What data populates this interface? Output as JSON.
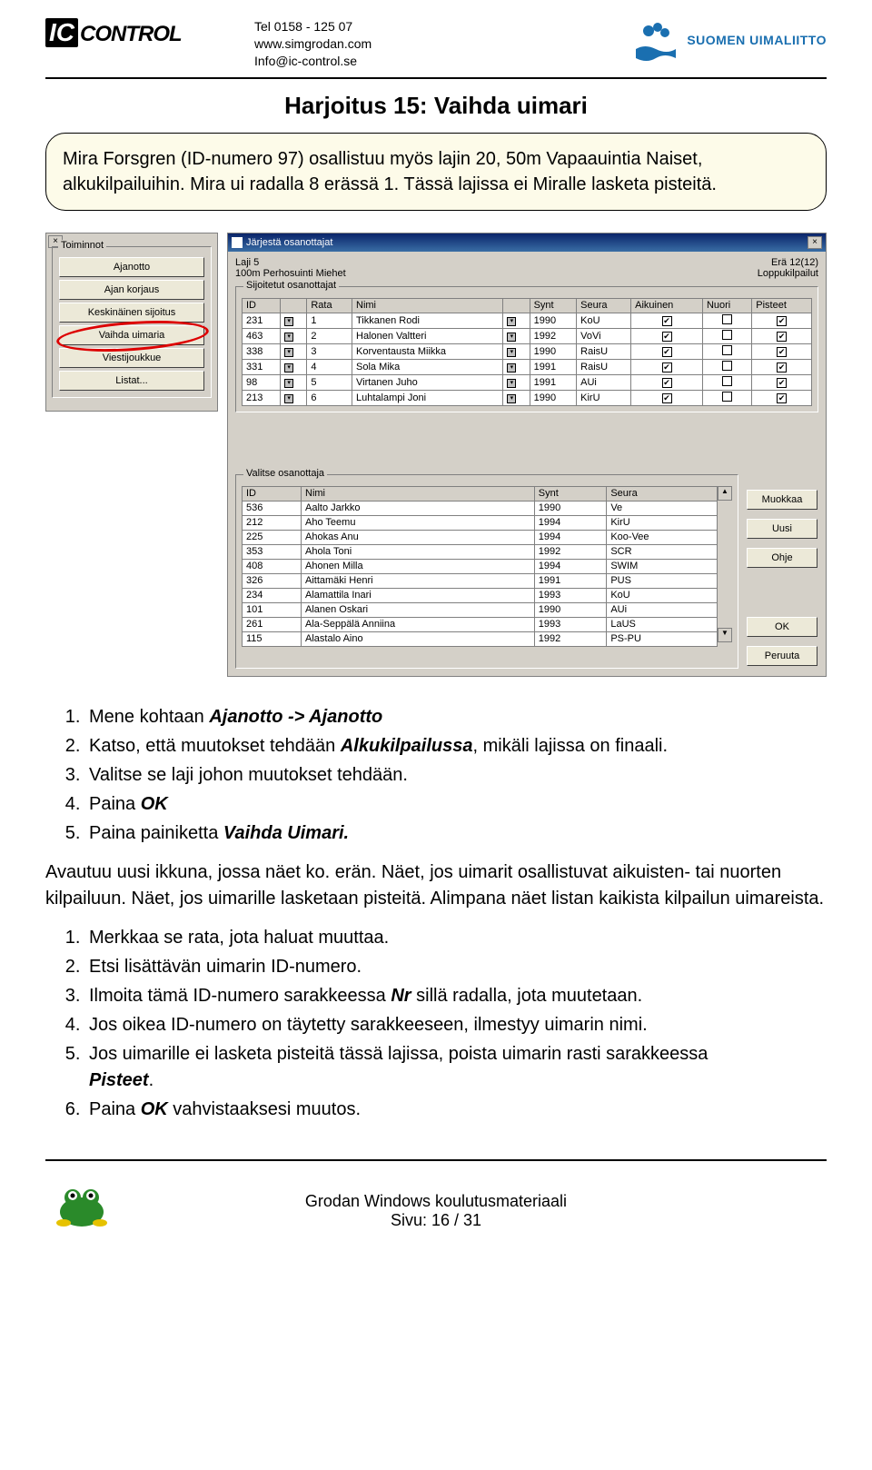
{
  "header": {
    "logo_ic": "IC",
    "logo_control": "CONTROL",
    "contact_line1": "Tel 0158 - 125 07",
    "contact_line2": "www.simgrodan.com",
    "contact_line3": "Info@ic-control.se",
    "org_name": "SUOMEN UIMALIITTO"
  },
  "title": "Harjoitus 15: Vaihda uimari",
  "callout": "Mira Forsgren (ID-numero 97) osallistuu myös lajin 20, 50m Vapaauintia Naiset, alkukilpailuihin. Mira ui radalla 8 erässä 1. Tässä lajissa ei Miralle lasketa pisteitä.",
  "toimpanel": {
    "close": "×",
    "legend": "Toiminnot",
    "buttons": [
      "Ajanotto",
      "Ajan korjaus",
      "Keskinäinen sijoitus",
      "Vaihda uimaria",
      "Viestijoukkue",
      "Listat..."
    ],
    "highlighted_index": 3
  },
  "dialog": {
    "title": "Järjestä osanottajat",
    "close": "×",
    "top_left_1": "Laji 5",
    "top_left_2": "100m Perhosuinti Miehet",
    "top_right_1": "Erä 12(12)",
    "top_right_2": "Loppukilpailut",
    "placed_legend": "Sijoitetut osanottajat",
    "placed_headers": [
      "ID",
      "",
      "Rata",
      "Nimi",
      "",
      "Synt",
      "Seura",
      "Aikuinen",
      "Nuori",
      "Pisteet"
    ],
    "placed_rows": [
      {
        "id": "231",
        "rata": "1",
        "nimi": "Tikkanen Rodi",
        "synt": "1990",
        "seura": "KoU",
        "aik": true,
        "nuori": false,
        "pist": true
      },
      {
        "id": "463",
        "rata": "2",
        "nimi": "Halonen Valtteri",
        "synt": "1992",
        "seura": "VoVi",
        "aik": true,
        "nuori": false,
        "pist": true
      },
      {
        "id": "338",
        "rata": "3",
        "nimi": "Korventausta Miikka",
        "synt": "1990",
        "seura": "RaisU",
        "aik": true,
        "nuori": false,
        "pist": true
      },
      {
        "id": "331",
        "rata": "4",
        "nimi": "Sola Mika",
        "synt": "1991",
        "seura": "RaisU",
        "aik": true,
        "nuori": false,
        "pist": true
      },
      {
        "id": "98",
        "rata": "5",
        "nimi": "Virtanen Juho",
        "synt": "1991",
        "seura": "AUi",
        "aik": true,
        "nuori": false,
        "pist": true
      },
      {
        "id": "213",
        "rata": "6",
        "nimi": "Luhtalampi Joni",
        "synt": "1990",
        "seura": "KirU",
        "aik": true,
        "nuori": false,
        "pist": true
      }
    ],
    "select_legend": "Valitse osanottaja",
    "select_headers": [
      "ID",
      "Nimi",
      "Synt",
      "Seura"
    ],
    "select_rows": [
      {
        "id": "536",
        "nimi": "Aalto Jarkko",
        "synt": "1990",
        "seura": "Ve"
      },
      {
        "id": "212",
        "nimi": "Aho Teemu",
        "synt": "1994",
        "seura": "KirU"
      },
      {
        "id": "225",
        "nimi": "Ahokas Anu",
        "synt": "1994",
        "seura": "Koo-Vee"
      },
      {
        "id": "353",
        "nimi": "Ahola Toni",
        "synt": "1992",
        "seura": "SCR"
      },
      {
        "id": "408",
        "nimi": "Ahonen Milla",
        "synt": "1994",
        "seura": "SWIM"
      },
      {
        "id": "326",
        "nimi": "Aittamäki Henri",
        "synt": "1991",
        "seura": "PUS"
      },
      {
        "id": "234",
        "nimi": "Alamattila Inari",
        "synt": "1993",
        "seura": "KoU"
      },
      {
        "id": "101",
        "nimi": "Alanen Oskari",
        "synt": "1990",
        "seura": "AUi"
      },
      {
        "id": "261",
        "nimi": "Ala-Seppälä Anniina",
        "synt": "1993",
        "seura": "LaUS"
      },
      {
        "id": "115",
        "nimi": "Alastalo Aino",
        "synt": "1992",
        "seura": "PS-PU"
      }
    ],
    "side_buttons": [
      "Muokkaa",
      "Uusi",
      "Ohje",
      "OK",
      "Peruuta"
    ]
  },
  "steps1": {
    "intro_1a": "Mene kohtaan ",
    "intro_1b": "Ajanotto -> Ajanotto",
    "s2a": "Katso, että muutokset tehdään ",
    "s2b": "Alkukilpailussa",
    "s2c": ", mikäli lajissa on finaali.",
    "s3": "Valitse se laji johon muutokset tehdään.",
    "s4a": "Paina ",
    "s4b": "OK",
    "s5a": "Paina painiketta ",
    "s5b": "Vaihda Uimari."
  },
  "para": "Avautuu uusi ikkuna, jossa näet ko. erän. Näet, jos uimarit osallistuvat aikuisten- tai nuorten kilpailuun. Näet, jos uimarille lasketaan pisteitä. Alimpana näet listan kaikista kilpailun uimareista.",
  "steps2": {
    "s1": "Merkkaa se rata, jota haluat muuttaa.",
    "s2": "Etsi lisättävän uimarin ID-numero.",
    "s3a": "Ilmoita tämä ID-numero sarakkeessa ",
    "s3b": "Nr",
    "s3c": " sillä radalla, jota muutetaan.",
    "s4": "Jos oikea ID-numero on täytetty sarakkeeseen, ilmestyy uimarin nimi.",
    "s5a": "Jos uimarille ei lasketa pisteitä tässä lajissa, poista uimarin rasti sarakkeessa",
    "s5b": "Pisteet",
    "s5c": ".",
    "s6a": "Paina ",
    "s6b": "OK",
    "s6c": " vahvistaaksesi muutos."
  },
  "footer": {
    "line1": "Grodan Windows koulutusmateriaali",
    "line2": "Sivu: 16 / 31"
  }
}
